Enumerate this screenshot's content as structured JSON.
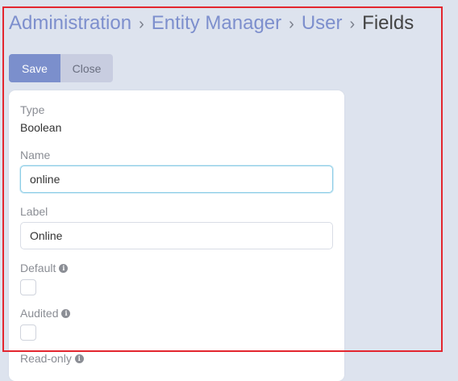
{
  "breadcrumb": {
    "items": [
      "Administration",
      "Entity Manager",
      "User"
    ],
    "separator": "›",
    "current": "Fields"
  },
  "buttons": {
    "save": "Save",
    "close": "Close"
  },
  "form": {
    "type": {
      "label": "Type",
      "value": "Boolean"
    },
    "name": {
      "label": "Name",
      "value": "online"
    },
    "label_field": {
      "label": "Label",
      "value": "Online"
    },
    "default": {
      "label": "Default"
    },
    "audited": {
      "label": "Audited"
    },
    "readonly": {
      "label": "Read-only"
    }
  },
  "icons": {
    "info": "info-icon"
  },
  "colors": {
    "accent": "#7b8fcc",
    "highlight": "#e3262f",
    "link": "#7d8fcd"
  }
}
